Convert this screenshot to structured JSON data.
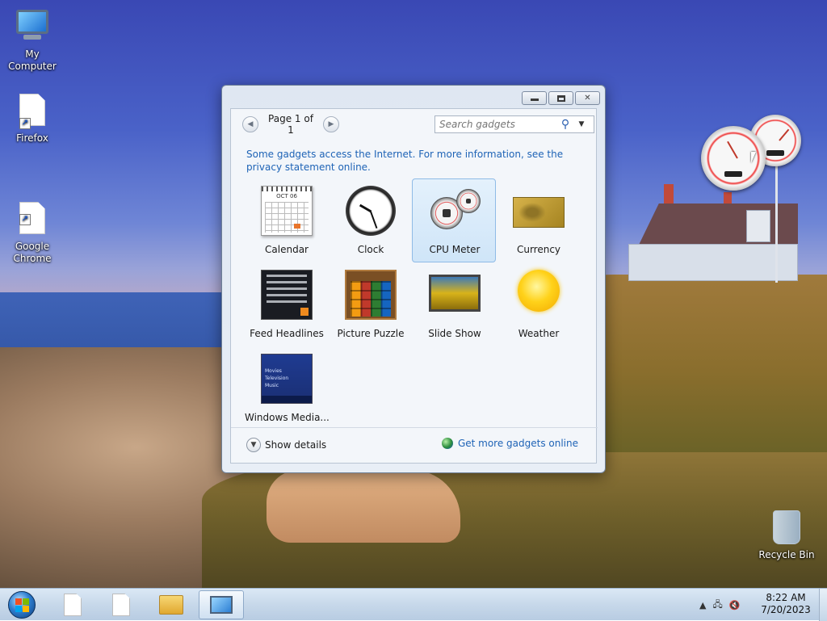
{
  "desktop": {
    "icons": [
      {
        "label": "My Computer",
        "icon": "computer-icon"
      },
      {
        "label": "Firefox",
        "icon": "file-shortcut-icon"
      },
      {
        "label": "Google\nChrome",
        "icon": "file-shortcut-icon"
      },
      {
        "label": "Recycle Bin",
        "icon": "recycle-bin-icon"
      }
    ]
  },
  "gadget_window": {
    "pager_text": "Page 1 of 1",
    "search_placeholder": "Search gadgets",
    "notice": "Some gadgets access the Internet.  For more information, see the privacy statement online.",
    "gadgets": [
      {
        "label": "Calendar",
        "selected": false
      },
      {
        "label": "Clock",
        "selected": false
      },
      {
        "label": "CPU Meter",
        "selected": true
      },
      {
        "label": "Currency",
        "selected": false
      },
      {
        "label": "Feed Headlines",
        "selected": false
      },
      {
        "label": "Picture Puzzle",
        "selected": false
      },
      {
        "label": "Slide Show",
        "selected": false
      },
      {
        "label": "Weather",
        "selected": false
      },
      {
        "label": "Windows Media...",
        "selected": false
      }
    ],
    "calendar_month": "OCT 06",
    "wmc_lines": [
      "Movies",
      "Television",
      "Music"
    ],
    "show_details": "Show details",
    "get_more": "Get more gadgets online"
  },
  "taskbar": {
    "time": "8:22 AM",
    "date": "7/20/2023"
  },
  "colors": {
    "link": "#1e63b6",
    "selection": "#cfe5f8"
  }
}
